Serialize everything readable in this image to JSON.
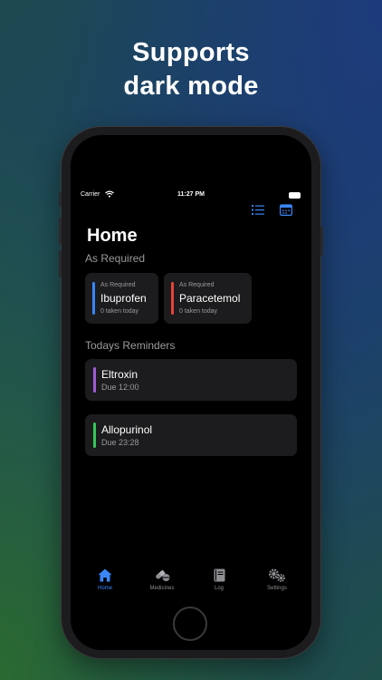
{
  "headline": {
    "line1": "Supports",
    "line2": "dark mode"
  },
  "status_bar": {
    "carrier": "Carrier",
    "time": "11:27 PM"
  },
  "toolbar": {
    "list_icon": "list-icon",
    "calendar_icon": "calendar-icon",
    "accent": "#3a86f7"
  },
  "page_title": "Home",
  "as_required": {
    "section_title": "As Required",
    "cards": [
      {
        "tag": "As Required",
        "name": "Ibuprofen",
        "sub": "0 taken today",
        "color": "#3a86f7"
      },
      {
        "tag": "As Required",
        "name": "Paracetemol",
        "sub": "0 taken today",
        "color": "#e5443a"
      }
    ]
  },
  "reminders": {
    "section_title": "Todays Reminders",
    "items": [
      {
        "name": "Eltroxin",
        "due": "Due 12:00",
        "color": "#a05bd6"
      },
      {
        "name": "Allopurinol",
        "due": "Due 23:28",
        "color": "#34c759"
      }
    ]
  },
  "tabbar": {
    "items": [
      {
        "label": "Home",
        "icon": "house-icon",
        "active": true
      },
      {
        "label": "Medicines",
        "icon": "pills-icon",
        "active": false
      },
      {
        "label": "Log",
        "icon": "book-icon",
        "active": false
      },
      {
        "label": "Settings",
        "icon": "gears-icon",
        "active": false
      }
    ]
  }
}
